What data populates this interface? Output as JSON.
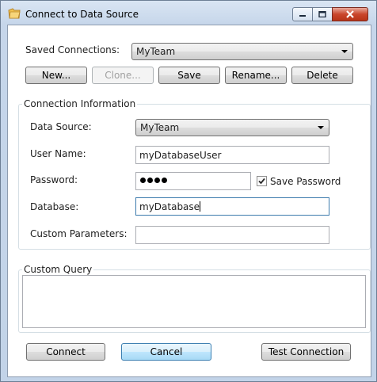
{
  "window": {
    "title": "Connect to Data Source",
    "icons": {
      "app": "folder-icon",
      "minimize": "minimize-icon",
      "maximize": "maximize-icon",
      "close": "close-icon"
    }
  },
  "saved": {
    "label": "Saved Connections:",
    "selected": "MyTeam",
    "buttons": {
      "new": "New...",
      "clone": "Clone...",
      "save": "Save",
      "rename": "Rename...",
      "delete": "Delete"
    }
  },
  "connection": {
    "group_title": "Connection Information",
    "data_source_label": "Data Source:",
    "data_source_value": "MyTeam",
    "user_name_label": "User Name:",
    "user_name_value": "myDatabaseUser",
    "password_label": "Password:",
    "password_length": 4,
    "save_password_label": "Save Password",
    "save_password_checked": true,
    "database_label": "Database:",
    "database_value": "myDatabase",
    "custom_params_label": "Custom Parameters:",
    "custom_params_value": ""
  },
  "query": {
    "group_title": "Custom Query",
    "value": ""
  },
  "footer": {
    "connect": "Connect",
    "cancel": "Cancel",
    "test": "Test Connection"
  }
}
